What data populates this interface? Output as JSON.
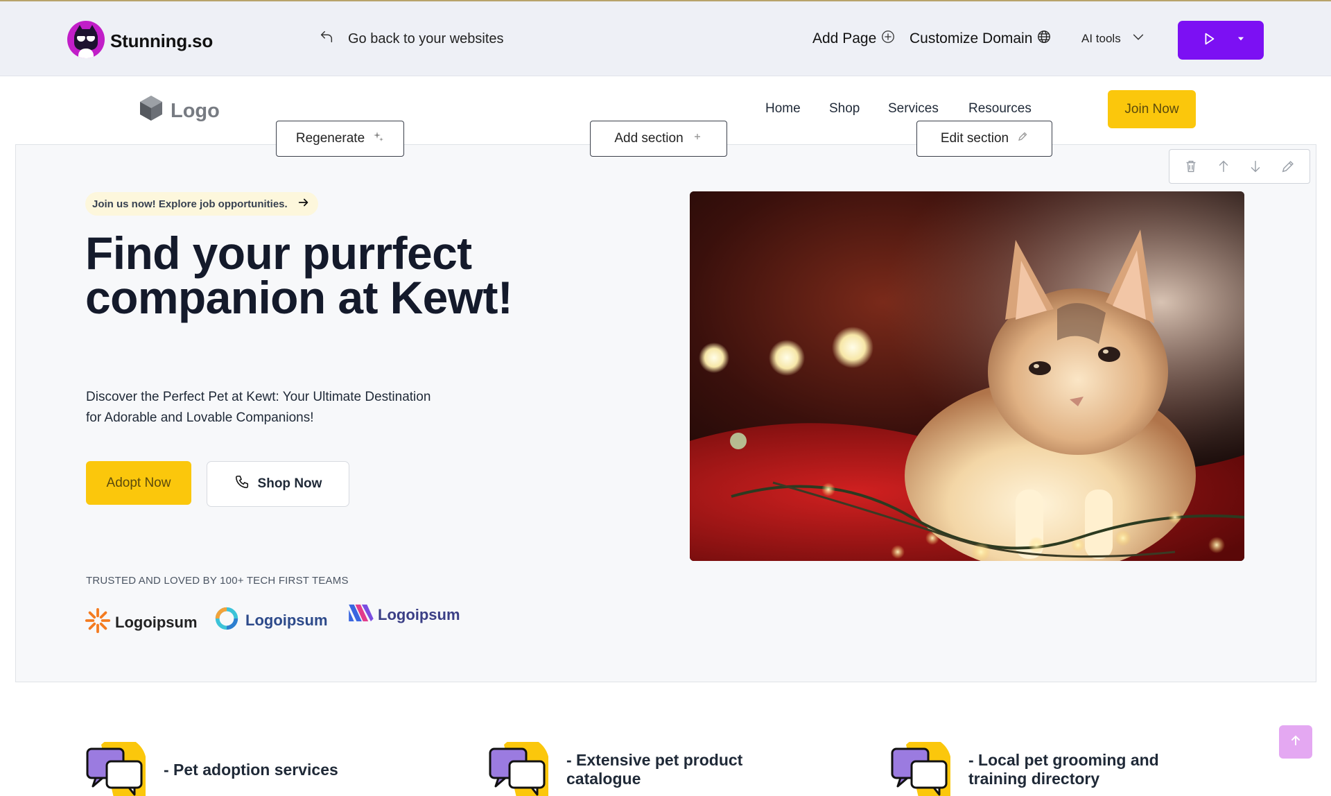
{
  "editor": {
    "brand_name": "Stunning.so",
    "back_label": "Go back to your websites",
    "add_page_label": "Add Page",
    "customize_domain_label": "Customize Domain",
    "ai_tools_label": "AI tools"
  },
  "site": {
    "logo_text": "Logo",
    "nav": [
      "Home",
      "Shop",
      "Services",
      "Resources"
    ],
    "join_label": "Join Now"
  },
  "section_controls": {
    "regenerate_label": "Regenerate",
    "add_section_label": "Add section",
    "edit_section_label": "Edit section"
  },
  "hero": {
    "pill_text": "Join us now! Explore job opportunities.",
    "headline": "Find your purrfect companion at Kewt!",
    "subtext": "Discover the Perfect Pet at Kewt: Your Ultimate Destination for Adorable and Lovable Companions!",
    "primary_cta": "Adopt Now",
    "secondary_cta": "Shop Now",
    "trusted_text": "TRUSTED AND LOVED BY 100+ TECH FIRST TEAMS",
    "partner_logos": [
      "Logoipsum",
      "Logoipsum",
      "Logoipsum"
    ]
  },
  "features": [
    "- Pet adoption services",
    "- Extensive pet product catalogue",
    "- Local pet grooming and training directory"
  ],
  "colors": {
    "editor_bar": "#eef0f6",
    "publish_purple": "#7c10f3",
    "cta_yellow": "#fbc70c",
    "headline": "#141a2b"
  }
}
